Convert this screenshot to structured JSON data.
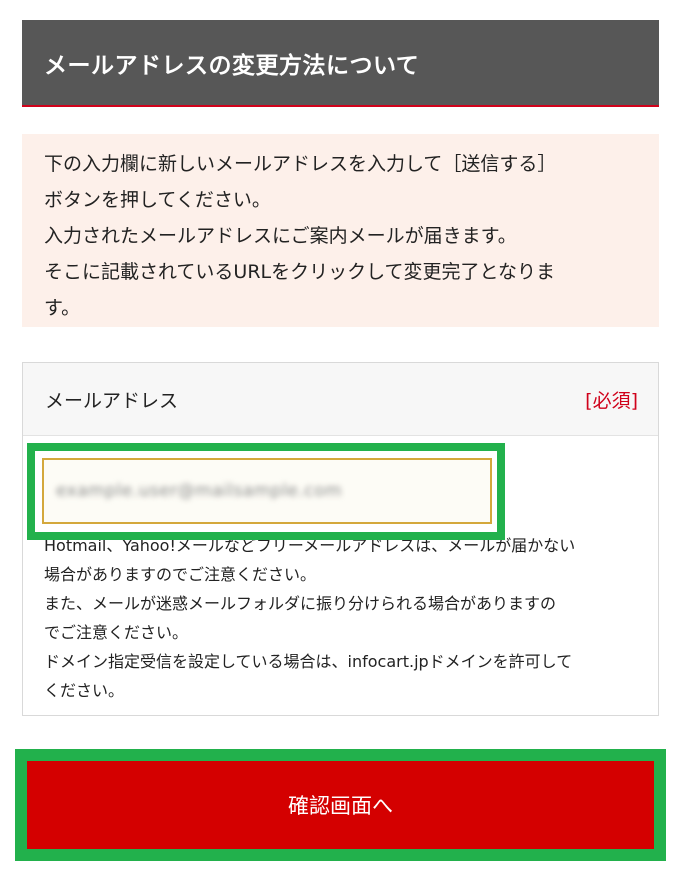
{
  "header": {
    "title": "メールアドレスの変更方法について"
  },
  "notice": {
    "lines": [
      "下の入力欄に新しいメールアドレスを入力して［送信する］",
      "ボタンを押してください。",
      "入力されたメールアドレスにご案内メールが届きます。",
      "そこに記載されているURLをクリックして変更完了となりま",
      "す。"
    ]
  },
  "form": {
    "label": "メールアドレス",
    "required": "[必須]",
    "email_value": "example.user@mailsample.com",
    "notes": [
      "Hotmail、Yahoo!メールなどフリーメールアドレスは、メールが届かない",
      "場合がありますのでご注意ください。",
      "また、メールが迷惑メールフォルダに振り分けられる場合がありますの",
      "でご注意ください。",
      "ドメイン指定受信を設定している場合は、infocart.jpドメインを許可して",
      "ください。"
    ]
  },
  "confirm_button": {
    "label": "確認画面へ"
  },
  "colors": {
    "header_bg": "#575757",
    "accent_red": "#d0021b",
    "button_red": "#d40000",
    "highlight_green": "#22b14c",
    "notice_bg": "#fdf0ea"
  }
}
